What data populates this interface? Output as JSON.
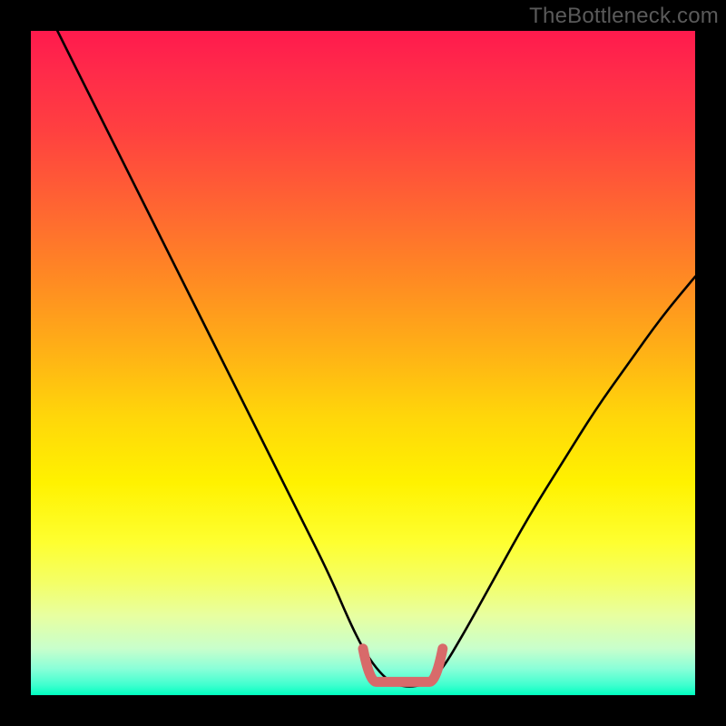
{
  "watermark": "TheBottleneck.com",
  "colors": {
    "background": "#000000",
    "curve": "#000000",
    "highlight_stroke": "#d86a6a",
    "highlight_fill": "none",
    "gradient_top": "#ff1a4d",
    "gradient_bottom": "#00ffc0"
  },
  "chart_data": {
    "type": "line",
    "title": "",
    "xlabel": "",
    "ylabel": "",
    "xlim": [
      0,
      100
    ],
    "ylim": [
      0,
      100
    ],
    "grid": false,
    "series": [
      {
        "name": "bottleneck-curve",
        "x": [
          4,
          10,
          15,
          20,
          25,
          30,
          35,
          40,
          45,
          48,
          50,
          52,
          54,
          56,
          58,
          60,
          62,
          65,
          70,
          75,
          80,
          85,
          90,
          95,
          100
        ],
        "y": [
          100,
          88,
          78,
          68,
          58,
          48,
          38,
          28,
          18,
          11,
          7,
          4,
          2,
          1.3,
          1.3,
          2,
          4,
          9,
          18,
          27,
          35,
          43,
          50,
          57,
          63
        ]
      }
    ],
    "annotations": [
      {
        "name": "low-bottleneck-highlight",
        "shape": "flat-U",
        "x_range": [
          50,
          62
        ],
        "y": 2
      }
    ]
  }
}
